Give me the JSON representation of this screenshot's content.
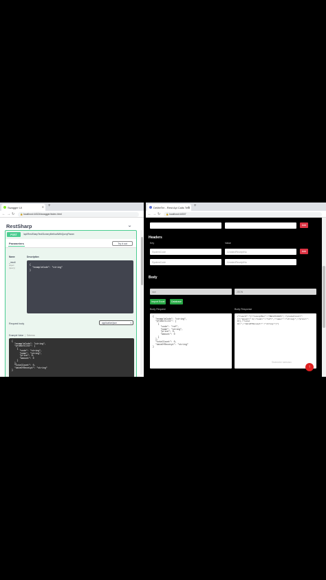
{
  "left_window": {
    "tab_title": "Swagger UI",
    "url": "localhost:44324/swagger/index.html",
    "api_title": "RestSharp",
    "operation": {
      "method": "POST",
      "path": "/api/RestSharpTest/DummyMethodWithQueryParam",
      "parameters_tab": "Parameters",
      "try_it_out": "Try it out",
      "col_name": "Name",
      "col_description": "Description",
      "param_name": "_result",
      "param_type": "object",
      "param_in": "(query)",
      "param_example": "{\n  \"exampleCode\": \"string\"\n}",
      "request_body_label": "Request body",
      "content_type": "application/json",
      "example_value_tab": "Example Value",
      "schema_tab": "Schema",
      "example_body": "{\n  \"exampleCode\": \"string\",\n  \"productList\": [\n    {\n      \"code\": \"string\",\n      \"name\": \"string\",\n      \"price\": 0,\n      \"amount\": 0\n    }\n  ],\n  \"totalCount\": 0,\n  \"dateOfReceipt\": \"string\"\n}"
    }
  },
  "right_window": {
    "tab_title": "DeMeTer - Rest Api Calls Test",
    "url": "localhost:44337",
    "add_label": "Add",
    "headers_title": "Headers",
    "key_label": "Key",
    "value_label": "Value",
    "header_key_1": "SystemCode",
    "header_value_1": "CreatedReceiptNo",
    "header_key_2": "SystemCode",
    "header_value_2": "CreatedReceiptNo",
    "body_title": "Body",
    "body_type_1": "raw",
    "body_type_2": "JSON",
    "import_button": "Import Excel",
    "database_button": "Database",
    "body_request_label": "Body Request",
    "body_response_label": "Body Response",
    "body_request": "{\n  \"exampleCode\": \"string\",\n  \"productList\": [\n    {\n      \"code\": \"ref\",\n      \"name\": \"string\",\n      \"price\": 0,\n      \"amount\": 0\n    }\n  ],\n  \"totalCount\": 0,\n  \"dateOfReceipt\": \"string\"\n}",
    "body_response": "{\"result\":\"{\\\"receiptNo\\\":\\\"REC8764645\\\",\\\"productList\\\":\n[{\\\"amount\\\":0,\\\"code\\\":\\\"ref\\\",\\\"name\\\":\\\"string\\\",\\\"price\\\":0}],\\\"total\n0}\\\",\\\"dateOfReceipt\\\":\\\"string\\\"}\"}",
    "footer_text": "Sistemler tabloları",
    "fab_icon": "arrow-up"
  }
}
